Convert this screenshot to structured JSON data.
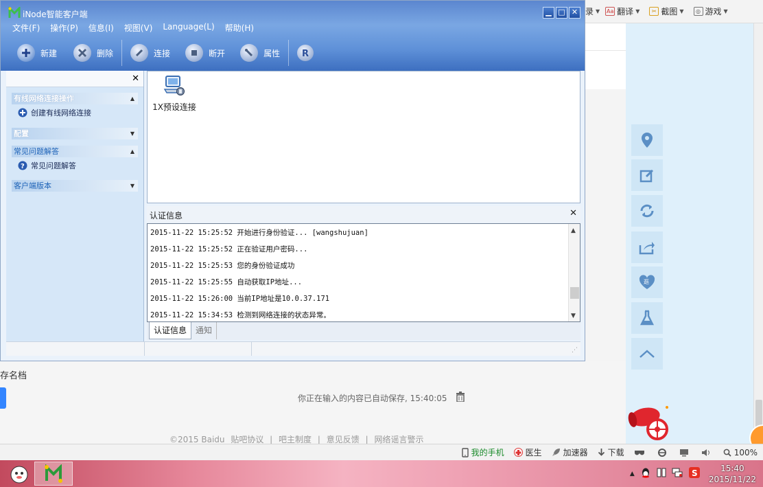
{
  "app": {
    "title": "iNode智能客户端",
    "menu": [
      "文件(F)",
      "操作(P)",
      "信息(I)",
      "视图(V)",
      "Language(L)",
      "帮助(H)"
    ],
    "toolbar": {
      "new_label": "新建",
      "delete_label": "删除",
      "connect_label": "连接",
      "disconnect_label": "断开",
      "properties_label": "属性"
    },
    "nav": {
      "sections": [
        {
          "title": "有线网络连接操作",
          "links": [
            "创建有线网络连接"
          ]
        },
        {
          "title": "配置",
          "links": []
        },
        {
          "title": "常见问题解答",
          "links": [
            "常见问题解答"
          ]
        },
        {
          "title": "客户端版本",
          "links": []
        }
      ]
    },
    "connection": {
      "name": "1X预设连接"
    },
    "auth_panel": {
      "title": "认证信息",
      "log": [
        "2015-11-22 15:25:52 开始进行身份验证... [wangshujuan]",
        "2015-11-22 15:25:52 正在验证用户密码...",
        "2015-11-22 15:25:53 您的身份验证成功",
        "2015-11-22 15:25:55 自动获取IP地址...",
        "2015-11-22 15:26:00 当前IP地址是10.0.37.171",
        "2015-11-22 15:34:53 检测到网络连接的状态异常。"
      ],
      "tabs": [
        "认证信息",
        "通知"
      ]
    }
  },
  "browser": {
    "toolbar": [
      "翻译",
      "截图",
      "游戏"
    ],
    "partial_left_label": "录",
    "archive_label": "存名档",
    "autosave_text": "你正在输入的内容已自动保存, 15:40:05",
    "footer": [
      "©2015 Baidu",
      "贴吧协议",
      "|",
      "吧主制度",
      "|",
      "意见反馈",
      "|",
      "网络谣言警示"
    ],
    "status": {
      "phone": "我的手机",
      "doctor": "医生",
      "accelerator": "加速器",
      "download": "下载",
      "zoom": "100%"
    }
  },
  "taskbar": {
    "time": "15:40",
    "date": "2015/11/22"
  },
  "colors": {
    "title_blue": "#5e90d8",
    "nav_bg": "#d6e7f8",
    "right_panel": "#dff0fb",
    "accent_link": "#1e63b8"
  }
}
